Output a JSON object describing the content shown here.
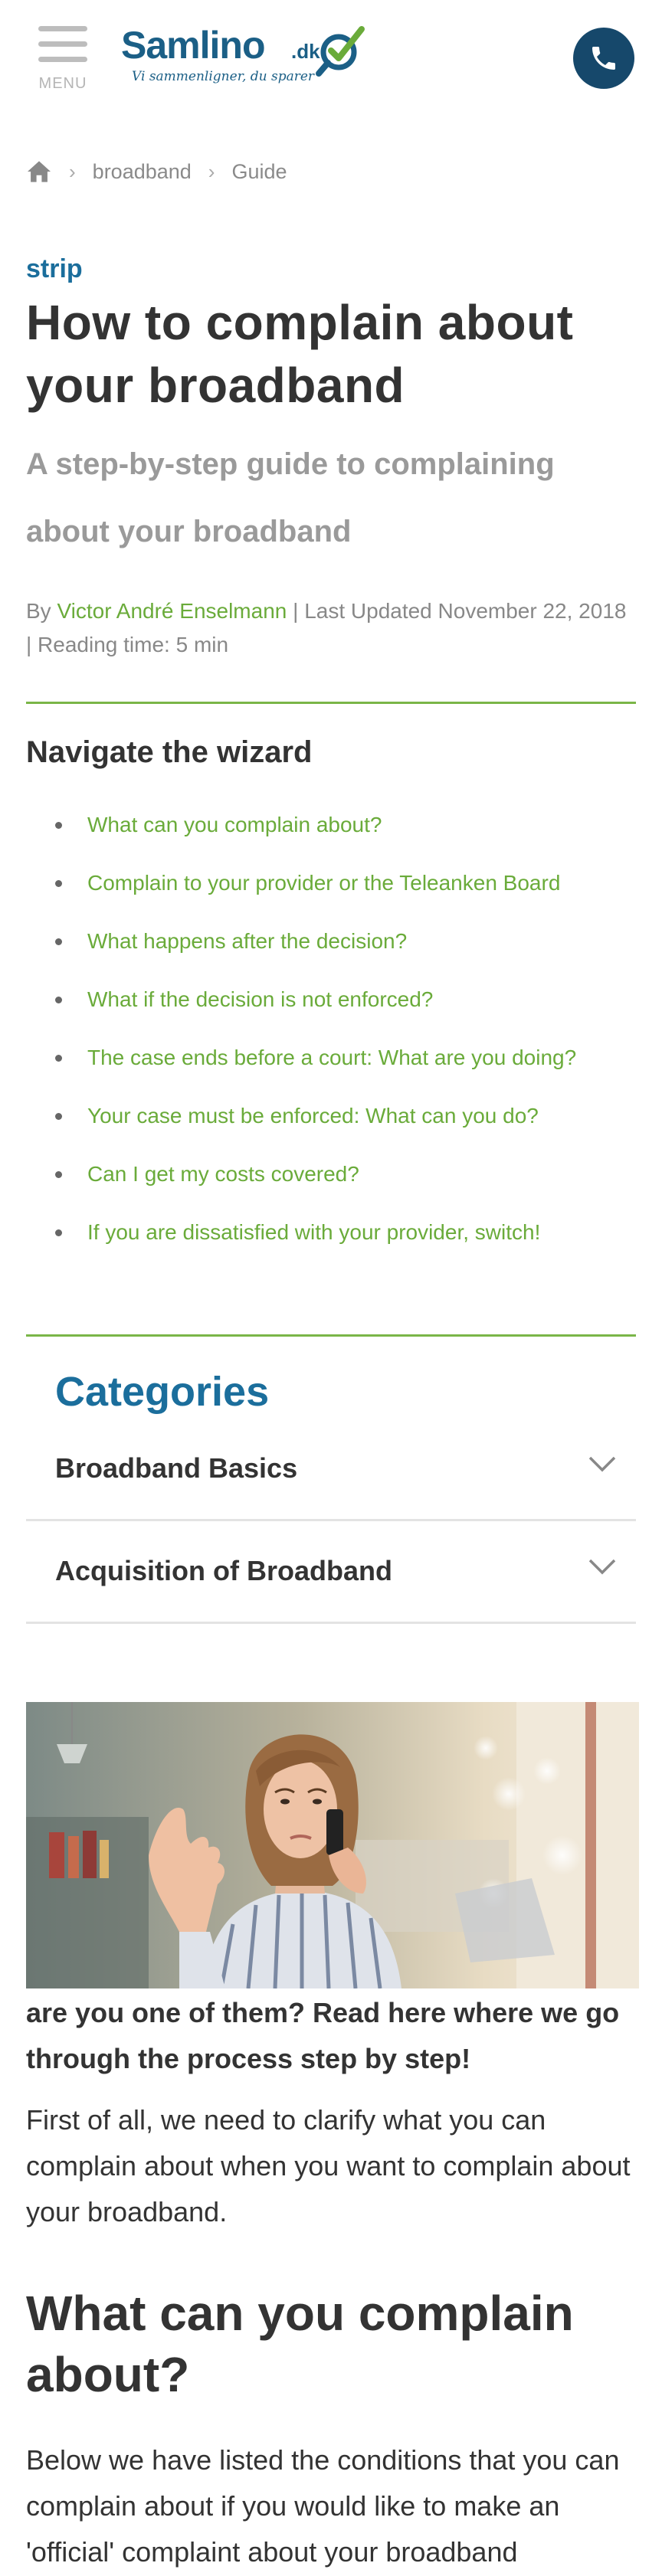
{
  "header": {
    "menu_label": "MENU",
    "logo_word": "Samlino",
    "logo_tld": ".dk",
    "logo_tagline": "Vi sammenligner, du sparer",
    "brand_color": "#1b5f86",
    "accent_color": "#6aab3a",
    "phone_icon": "phone-icon"
  },
  "breadcrumb": {
    "home_icon": "home-icon",
    "items": [
      "broadband",
      "Guide"
    ]
  },
  "article": {
    "kicker": "strip",
    "title": "How to complain about your broadband",
    "subtitle": "A step-by-step guide to complaining about your broadband",
    "byline_prefix": "By ",
    "author": "Victor André Enselmann",
    "byline_suffix": " | Last Updated November 22, 2018 | Reading time: 5 min"
  },
  "wizard": {
    "title": "Navigate the wizard",
    "items": [
      "What can you complain about?",
      "Complain to your provider or the Teleanken Board",
      "What happens after the decision?",
      "What if the decision is not enforced?",
      "The case ends before a court: What are you doing?",
      "Your case must be enforced: What can you do?",
      "Can I get my costs covered?",
      "If you are dissatisfied with your provider, switch!"
    ]
  },
  "categories": {
    "title": "Categories",
    "items": [
      {
        "label": "Broadband Basics",
        "icon": "chevron-down-icon"
      },
      {
        "label": "Acquisition of Broadband",
        "icon": "chevron-down-icon"
      }
    ]
  },
  "body": {
    "lead": "are you one of them? Read here where we go through the process step by step!",
    "para1": "First of all, we need to clarify what you can complain about when you want to complain about your broadband.",
    "heading": "What can you complain about?",
    "para2": "Below we have listed the conditions that you can complain about if you would like to make an 'official' complaint about your broadband"
  }
}
